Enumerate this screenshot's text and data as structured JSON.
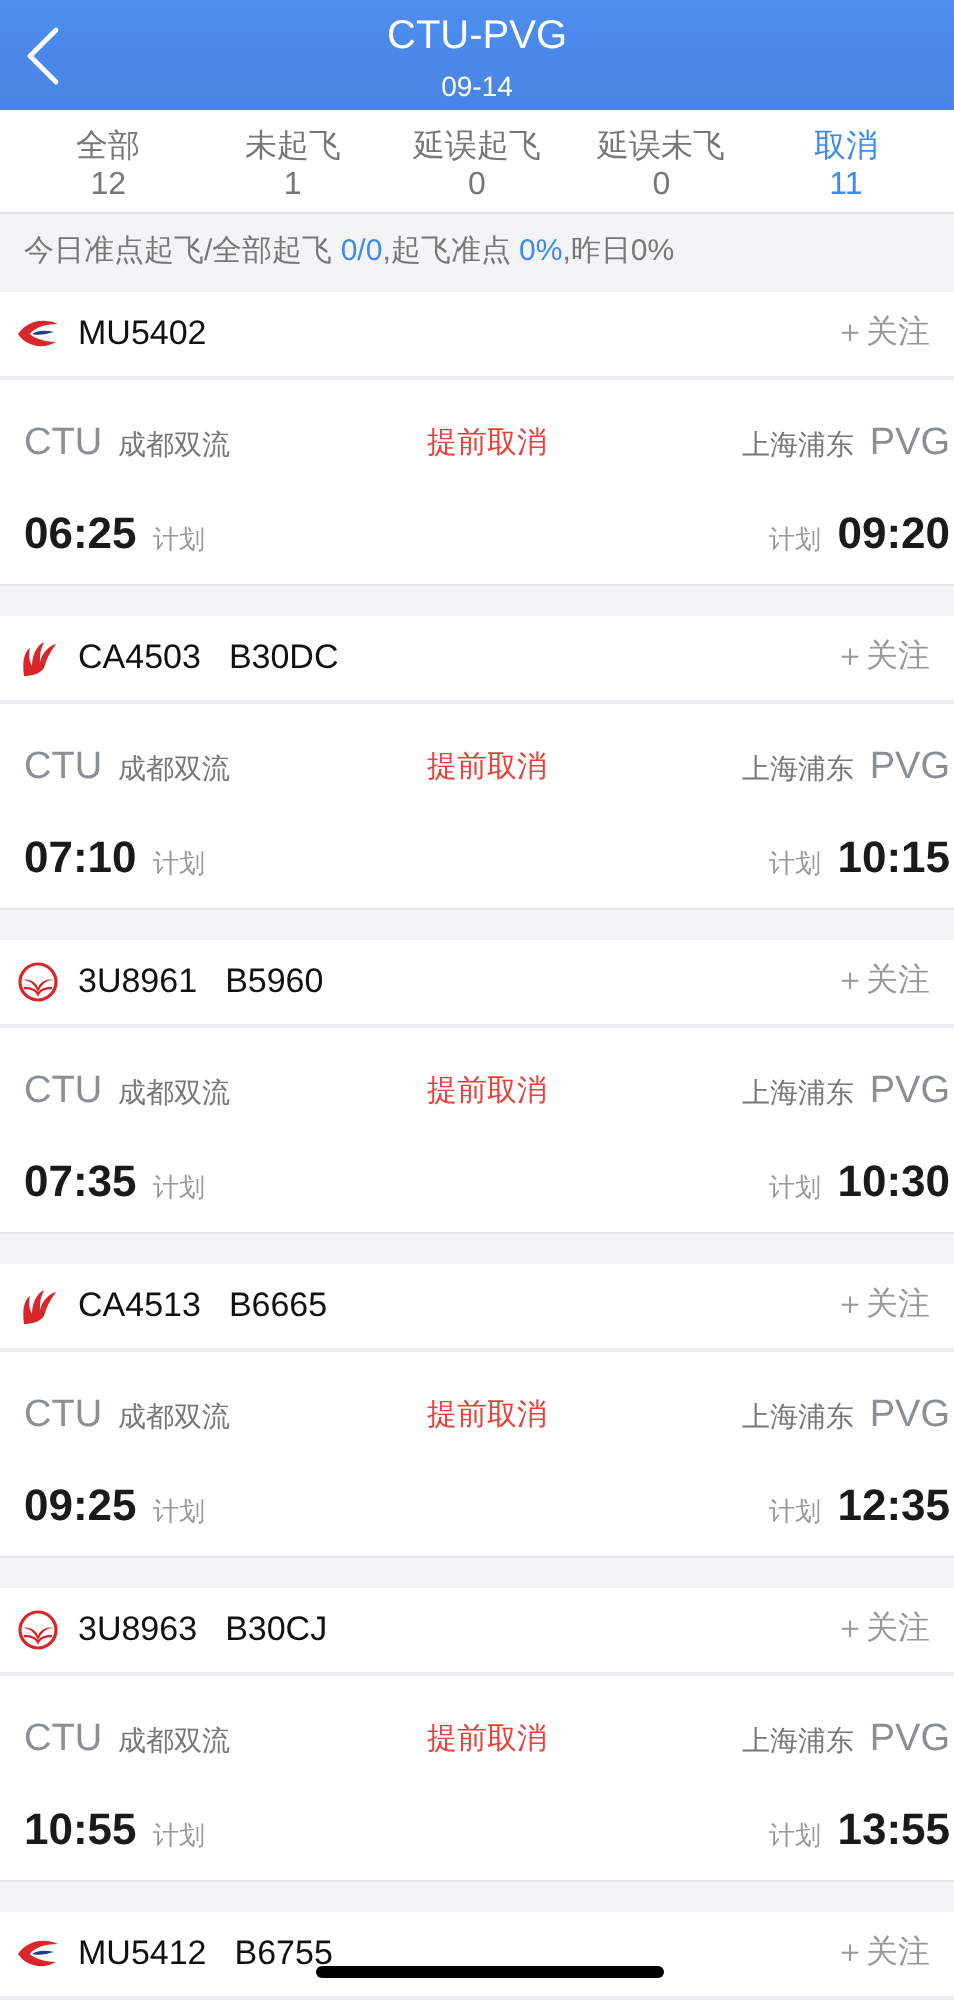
{
  "header": {
    "title": "CTU-PVG",
    "date": "09-14"
  },
  "tabs": [
    {
      "label": "全部",
      "count": "12",
      "selected": false
    },
    {
      "label": "未起飞",
      "count": "1",
      "selected": false
    },
    {
      "label": "延误起飞",
      "count": "0",
      "selected": false
    },
    {
      "label": "延误未飞",
      "count": "0",
      "selected": false
    },
    {
      "label": "取消",
      "count": "11",
      "selected": true
    }
  ],
  "summary": [
    {
      "text": "今日准点起飞/全部起飞 ",
      "highlight": false
    },
    {
      "text": "0/0",
      "highlight": true
    },
    {
      "text": ",起飞准点 ",
      "highlight": false
    },
    {
      "text": "0%",
      "highlight": true
    },
    {
      "text": ",昨日0%",
      "highlight": false
    }
  ],
  "flights": [
    {
      "kind": "eastern",
      "flight": "MU5402",
      "follow": "＋关注",
      "dep_code": "CTU",
      "dep_name": "成都双流",
      "status": "提前取消",
      "arr_name": "上海浦东",
      "arr_code": "PVG",
      "dep_time": "06:25",
      "dep_label": "计划",
      "arr_label": "计划",
      "arr_time": "09:20"
    },
    {
      "kind": "airchina",
      "flight": "CA4503",
      "reg": "B30DC",
      "follow": "＋关注",
      "dep_code": "CTU",
      "dep_name": "成都双流",
      "status": "提前取消",
      "arr_name": "上海浦东",
      "arr_code": "PVG",
      "dep_time": "07:10",
      "dep_label": "计划",
      "arr_label": "计划",
      "arr_time": "10:15"
    },
    {
      "kind": "sichuan",
      "flight": "3U8961",
      "reg": "B5960",
      "follow": "＋关注",
      "dep_code": "CTU",
      "dep_name": "成都双流",
      "status": "提前取消",
      "arr_name": "上海浦东",
      "arr_code": "PVG",
      "dep_time": "07:35",
      "dep_label": "计划",
      "arr_label": "计划",
      "arr_time": "10:30"
    },
    {
      "kind": "airchina",
      "flight": "CA4513",
      "reg": "B6665",
      "follow": "＋关注",
      "dep_code": "CTU",
      "dep_name": "成都双流",
      "status": "提前取消",
      "arr_name": "上海浦东",
      "arr_code": "PVG",
      "dep_time": "09:25",
      "dep_label": "计划",
      "arr_label": "计划",
      "arr_time": "12:35"
    },
    {
      "kind": "sichuan",
      "flight": "3U8963",
      "reg": "B30CJ",
      "follow": "＋关注",
      "dep_code": "CTU",
      "dep_name": "成都双流",
      "status": "提前取消",
      "arr_name": "上海浦东",
      "arr_code": "PVG",
      "dep_time": "10:55",
      "dep_label": "计划",
      "arr_label": "计划",
      "arr_time": "13:55"
    },
    {
      "kind": "eastern",
      "flight": "MU5412",
      "reg": "B6755",
      "follow": "＋关注"
    }
  ]
}
